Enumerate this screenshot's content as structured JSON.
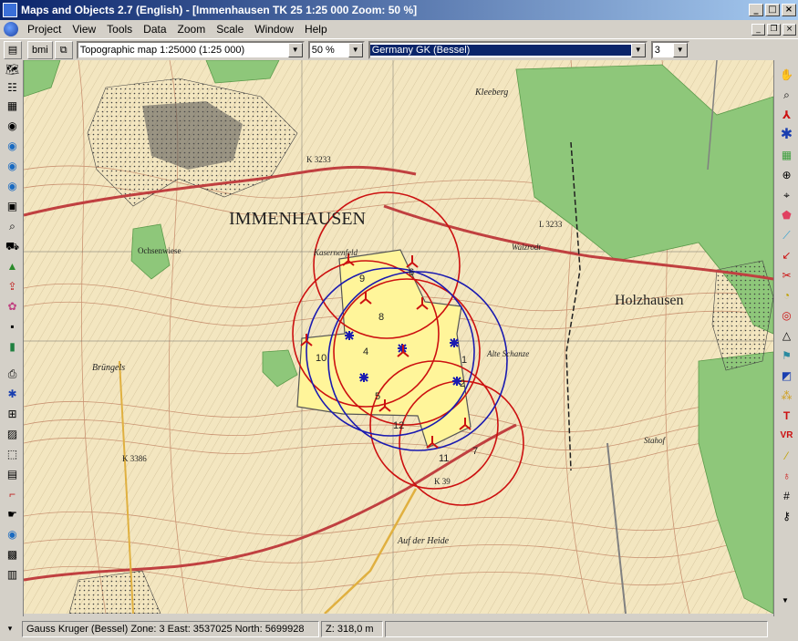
{
  "window": {
    "title": "Maps and Objects 2.7 (English) - [Immenhausen TK 25 1:25 000 Zoom: 50 %]",
    "minimize": "_",
    "maximize": "□",
    "close": "×",
    "mdi_minimize": "_",
    "mdi_restore": "❐",
    "mdi_close": "×"
  },
  "menu": [
    "Project",
    "View",
    "Tools",
    "Data",
    "Zoom",
    "Scale",
    "Window",
    "Help"
  ],
  "toolbar": {
    "bmi_label": "bmi",
    "map_select": "Topographic map 1:25000 (1:25 000)",
    "zoom_select": "50 %",
    "projection_select": "Germany GK (Bessel)",
    "zone_select": "3"
  },
  "left_tools": [
    "map-icon",
    "map-list-icon",
    "layers-icon",
    "globe-icon",
    "globe-icon-2",
    "globe-icon-3",
    "globe-icon-4",
    "camera-icon",
    "search-map-icon",
    "truck-icon",
    "terrain-icon",
    "export-icon",
    "palette-icon",
    "save-icon",
    "color-bar-icon",
    "printer-icon",
    "markers-icon",
    "network-icon",
    "image-icon",
    "dotted-box-icon",
    "calculator-icon",
    "crop-icon",
    "hand-cursor-icon",
    "globe-icon-5",
    "picture-icon",
    "bitmap-icon"
  ],
  "right_tools": [
    "pan-hand-icon",
    "zoom-icon",
    "wind-turbine-icon",
    "asterisk-icon",
    "grid-icon",
    "compass-icon",
    "crosshair-icon",
    "polygon-icon",
    "ruler-icon",
    "arrow-icon",
    "scissors-icon",
    "circle-segment-icon",
    "target-icon",
    "triangle-icon",
    "flag-icon",
    "circle-icon",
    "text-tool-icon",
    "vr-icon",
    "line-icon",
    "marker-icon",
    "hash-icon",
    "satellite-icon",
    "lock-icon"
  ],
  "map": {
    "town_label": "IMMENHAUSEN",
    "village_label": "Holzhausen",
    "place_labels": [
      "Brüngels",
      "Alte Schanze",
      "Auf der Heide",
      "Stahof",
      "Kleeberg",
      "Walzrodt",
      "Kasernenfeld",
      "Ochsenwiese"
    ],
    "road_labels": [
      "K 3233",
      "K 39",
      "K 3386",
      "L 3233"
    ],
    "area_numbers": [
      "1",
      "2",
      "4",
      "5",
      "6",
      "7",
      "8",
      "9",
      "10",
      "11",
      "12"
    ],
    "colors": {
      "background": "#f3e6c0",
      "forest": "#8ec77a",
      "contour": "#c08060",
      "built": "#505050",
      "site": "#fff59a",
      "red_circle": "#cc1010",
      "blue_circle": "#1a1ab0"
    }
  },
  "status": {
    "coords": "Gauss Kruger (Bessel) Zone: 3  East: 3537025  North: 5699928",
    "elevation": "Z: 318,0 m",
    "extra": ""
  }
}
